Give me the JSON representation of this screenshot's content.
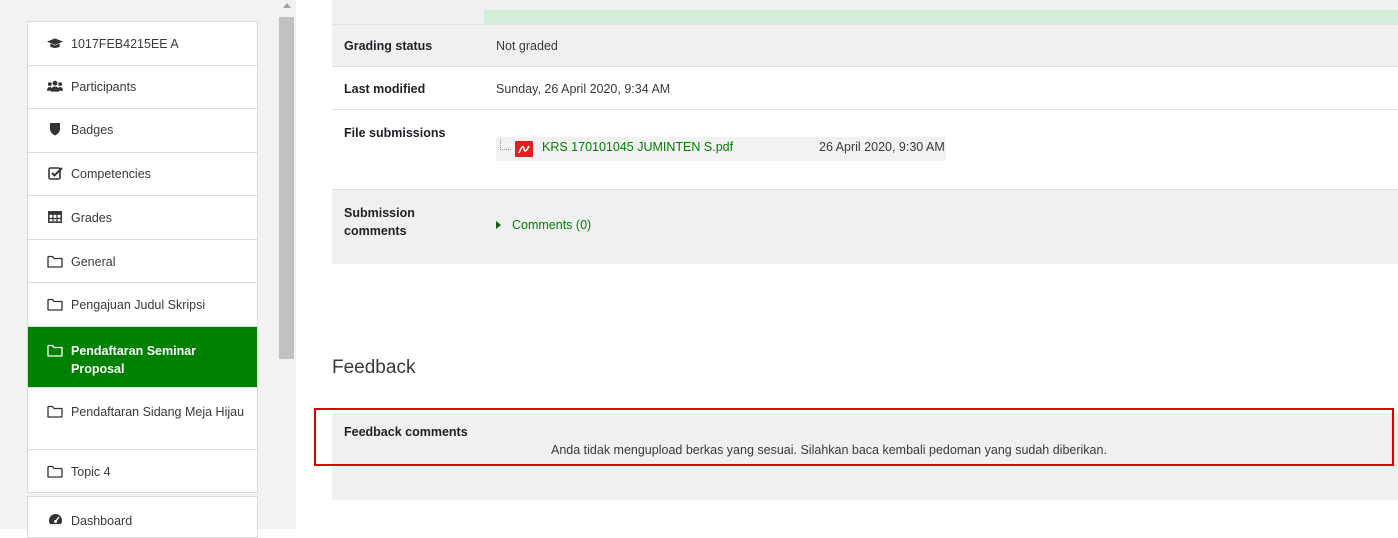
{
  "sidebar": {
    "items": [
      {
        "label": "1017FEB4215EE A",
        "icon": "graduation-cap-icon"
      },
      {
        "label": "Participants",
        "icon": "users-icon"
      },
      {
        "label": "Badges",
        "icon": "shield-icon"
      },
      {
        "label": "Competencies",
        "icon": "check-square-icon"
      },
      {
        "label": "Grades",
        "icon": "table-icon"
      },
      {
        "label": "General",
        "icon": "folder-icon"
      },
      {
        "label": "Pengajuan Judul Skripsi",
        "icon": "folder-icon"
      },
      {
        "label": "Pendaftaran Seminar Proposal",
        "icon": "folder-icon",
        "active": true
      },
      {
        "label": "Pendaftaran Sidang Meja Hijau",
        "icon": "folder-icon"
      },
      {
        "label": "Topic 4",
        "icon": "folder-icon"
      }
    ],
    "dashboard": {
      "label": "Dashboard",
      "icon": "tachometer-icon"
    }
  },
  "submission": {
    "grading_status_label": "Grading status",
    "grading_status_value": "Not graded",
    "last_modified_label": "Last modified",
    "last_modified_value": "Sunday, 26 April 2020, 9:34 AM",
    "file_submissions_label": "File submissions",
    "file_name": "KRS 170101045 JUMINTEN S.pdf",
    "file_date": "26 April 2020, 9:30 AM",
    "submission_comments_label_1": "Submission",
    "submission_comments_label_2": "comments",
    "comments_link": "Comments (0)"
  },
  "feedback": {
    "heading": "Feedback",
    "comments_label": "Feedback comments",
    "comments_text": "Anda tidak mengupload berkas yang sesuai. Silahkan baca kembali pedoman yang sudah diberikan."
  },
  "colors": {
    "accent": "#008000",
    "highlight_border": "#e00000",
    "status_strip": "#d4edda"
  }
}
